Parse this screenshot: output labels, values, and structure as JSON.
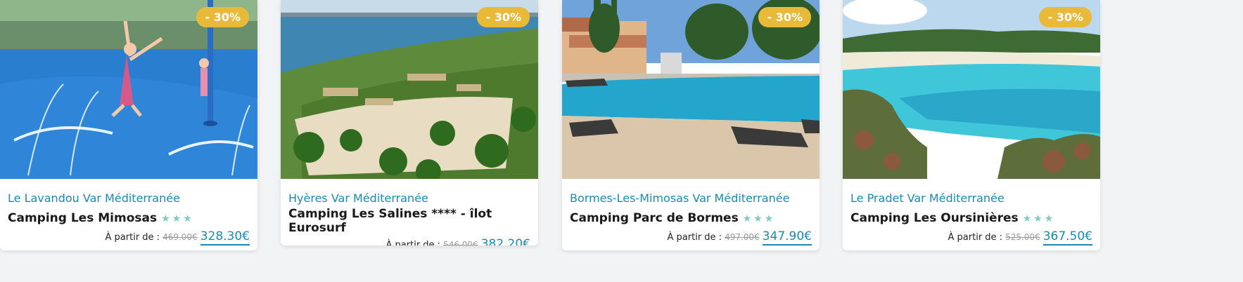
{
  "cards": [
    {
      "discount": "- 30%",
      "location": "Le Lavandou Var Méditerranée",
      "name": "Camping Les Mimosas",
      "stars": "★★★",
      "from_label": "À partir de :",
      "old_price": "469.00€",
      "new_price": "328.30€",
      "photo": "kids-water-splash-pad"
    },
    {
      "discount": "- 30%",
      "location": "Hyères Var Méditerranée",
      "name": "Camping Les Salines **** - îlot Eurosurf",
      "stars": "",
      "from_label": "À partir de :",
      "old_price": "546.00€",
      "new_price": "382.20€",
      "photo": "aerial-beach-camp-palms"
    },
    {
      "discount": "- 30%",
      "location": "Bormes-Les-Mimosas Var Méditerranée",
      "name": "Camping Parc de Bormes",
      "stars": "★★★",
      "from_label": "À partir de :",
      "old_price": "497.00€",
      "new_price": "347.90€",
      "photo": "swimming-pool-loungers"
    },
    {
      "discount": "- 30%",
      "location": "Le Pradet Var Méditerranée",
      "name": "Camping Les Oursinières",
      "stars": "★★★",
      "from_label": "À partir de :",
      "old_price": "525.00€",
      "new_price": "367.50€",
      "photo": "turquoise-cove-coast"
    }
  ],
  "colors": {
    "accent": "#1a8ab4",
    "badge": "#e9b93a",
    "stars": "#7ecac7"
  }
}
